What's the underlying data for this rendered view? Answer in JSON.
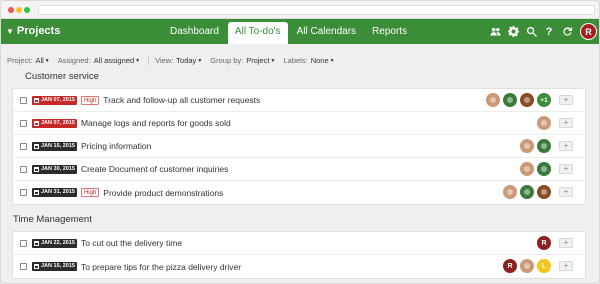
{
  "header": {
    "brand": "Projects",
    "tabs": [
      {
        "label": "Dashboard"
      },
      {
        "label": "All To-do's"
      },
      {
        "label": "All Calendars"
      },
      {
        "label": "Reports"
      }
    ],
    "user_initial": "R",
    "accent": "#3c8d38"
  },
  "filters": {
    "project_label": "Project:",
    "project_value": "All",
    "assigned_label": "Assigned:",
    "assigned_value": "All assigned",
    "view_label": "View:",
    "view_value": "Today",
    "group_label": "Group by:",
    "group_value": "Project",
    "labels_label": "Labels:",
    "labels_value": "None"
  },
  "sections": [
    {
      "title": "Customer service",
      "rows": [
        {
          "date": "JAN 07, 2015",
          "priority": "High",
          "task": "Track and follow-up all customer requests",
          "extra": "+1"
        },
        {
          "date": "JAN 07, 2015",
          "priority": "",
          "task": "Manage logs and reports for goods sold"
        },
        {
          "date": "JAN 15, 2015",
          "priority": "",
          "task": "Pricing information"
        },
        {
          "date": "JAN 30, 2015",
          "priority": "",
          "task": "Create Document of customer inquiries"
        },
        {
          "date": "JAN 31, 2015",
          "priority": "High",
          "task": "Provide product demonstrations"
        }
      ]
    },
    {
      "title": "Time Management",
      "rows": [
        {
          "date": "JAN 22, 2015",
          "priority": "",
          "task": "To cut out the delivery time",
          "avatar_initial": "R"
        },
        {
          "date": "JAN 15, 2015",
          "priority": "",
          "task": "To prepare tips for the pizza delivery driver",
          "avatar_initial": "R",
          "avatar_initial_2": "L"
        }
      ]
    }
  ],
  "add_label": "+"
}
